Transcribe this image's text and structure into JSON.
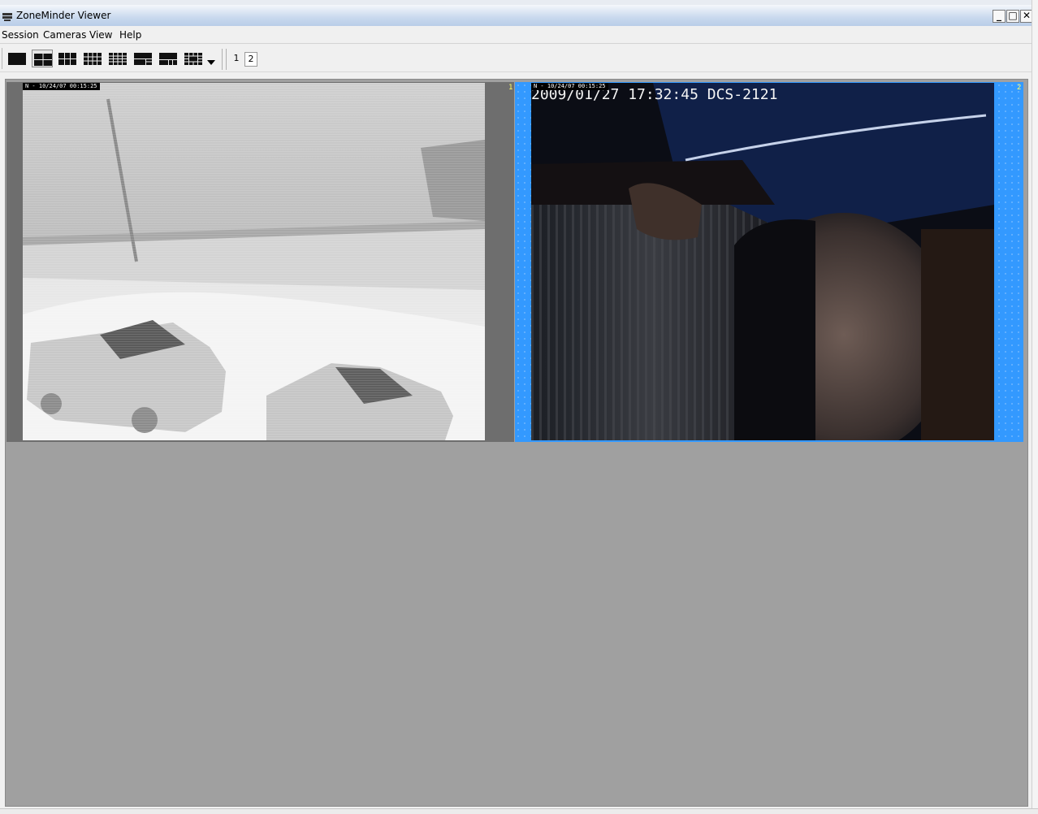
{
  "window": {
    "title": "ZoneMinder Viewer"
  },
  "window_controls": {
    "minimize": "_",
    "maximize": "□",
    "close": "✕"
  },
  "menu": {
    "items": [
      "Session",
      "Cameras",
      "View",
      "Help"
    ]
  },
  "toolbar": {
    "layout_buttons": [
      {
        "icon": "layout-1x1-icon",
        "active": false
      },
      {
        "icon": "layout-2x2-icon",
        "active": true
      },
      {
        "icon": "layout-3x2-icon",
        "active": false
      },
      {
        "icon": "layout-4x3-icon",
        "active": false
      },
      {
        "icon": "layout-4x4-icon",
        "active": false
      },
      {
        "icon": "layout-custom-a-icon",
        "active": false
      },
      {
        "icon": "layout-custom-b-icon",
        "active": false
      },
      {
        "icon": "layout-custom-c-icon",
        "active": false
      }
    ],
    "pages": [
      "1",
      "2"
    ],
    "active_page": "2"
  },
  "cameras": [
    {
      "number": "1",
      "stamp": "N - 10/24/07 00:15:25",
      "selected": false
    },
    {
      "number": "2",
      "stamp": "N - 10/24/07 00:15:25",
      "selected": true,
      "overlay": "2009/01/27 17:32:45 DCS-2121"
    }
  ],
  "colors": {
    "selection": "#3399ff",
    "viewport": "#a0a0a0",
    "number_label": "#ffff66"
  }
}
